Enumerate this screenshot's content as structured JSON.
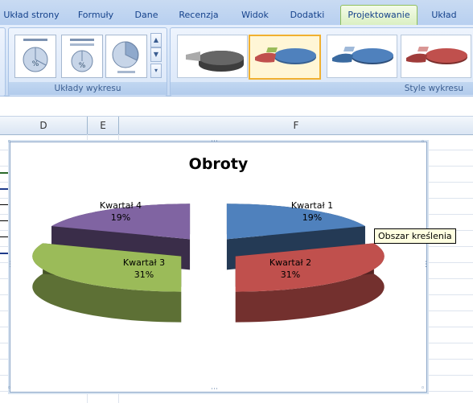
{
  "ribbon": {
    "tabs": [
      "Układ strony",
      "Formuły",
      "Dane",
      "Recenzja",
      "Widok",
      "Dodatki",
      "Projektowanie",
      "Układ"
    ],
    "active_tab": "Projektowanie",
    "groups": {
      "chart_layouts_label": "Układy wykresu",
      "chart_styles_label": "Style wykresu"
    },
    "layout_thumbnails": [
      "%",
      "%",
      ""
    ],
    "colors": {
      "active_tab_green": "#d9efc1",
      "selected_style_border": "#f0b030"
    }
  },
  "sheet": {
    "columns": [
      "D",
      "E",
      "F"
    ]
  },
  "chart": {
    "title": "Obroty",
    "tooltip": "Obszar kreślenia"
  },
  "chart_data": {
    "type": "pie",
    "title": "Obroty",
    "exploded": true,
    "three_d": true,
    "categories": [
      "Kwartał 1",
      "Kwartał 2",
      "Kwartał 3",
      "Kwartał 4"
    ],
    "values": [
      19,
      31,
      31,
      19
    ],
    "value_labels": [
      "19%",
      "31%",
      "31%",
      "19%"
    ],
    "colors": [
      "#4f81bd",
      "#c0504d",
      "#9bbb59",
      "#8064a2"
    ]
  }
}
